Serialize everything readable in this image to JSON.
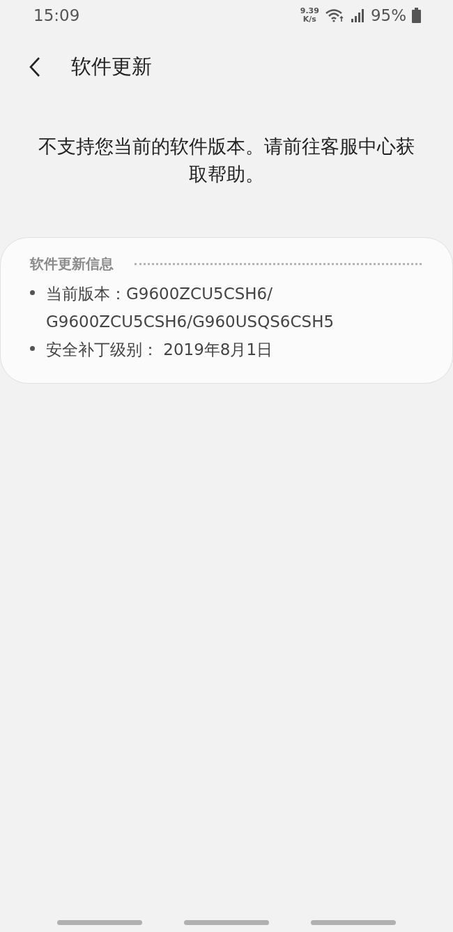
{
  "status_bar": {
    "time": "15:09",
    "net_speed_value": "9.39",
    "net_speed_unit": "K/s",
    "battery": "95%"
  },
  "header": {
    "title": "软件更新"
  },
  "message": "不支持您当前的软件版本。请前往客服中心获取帮助。",
  "info_card": {
    "title": "软件更新信息",
    "items": [
      {
        "lines": [
          "当前版本：G9600ZCU5CSH6/",
          "G9600ZCU5CSH6/G960USQS6CSH5"
        ]
      },
      {
        "lines": [
          "安全补丁级别： 2019年8月1日"
        ]
      }
    ]
  }
}
